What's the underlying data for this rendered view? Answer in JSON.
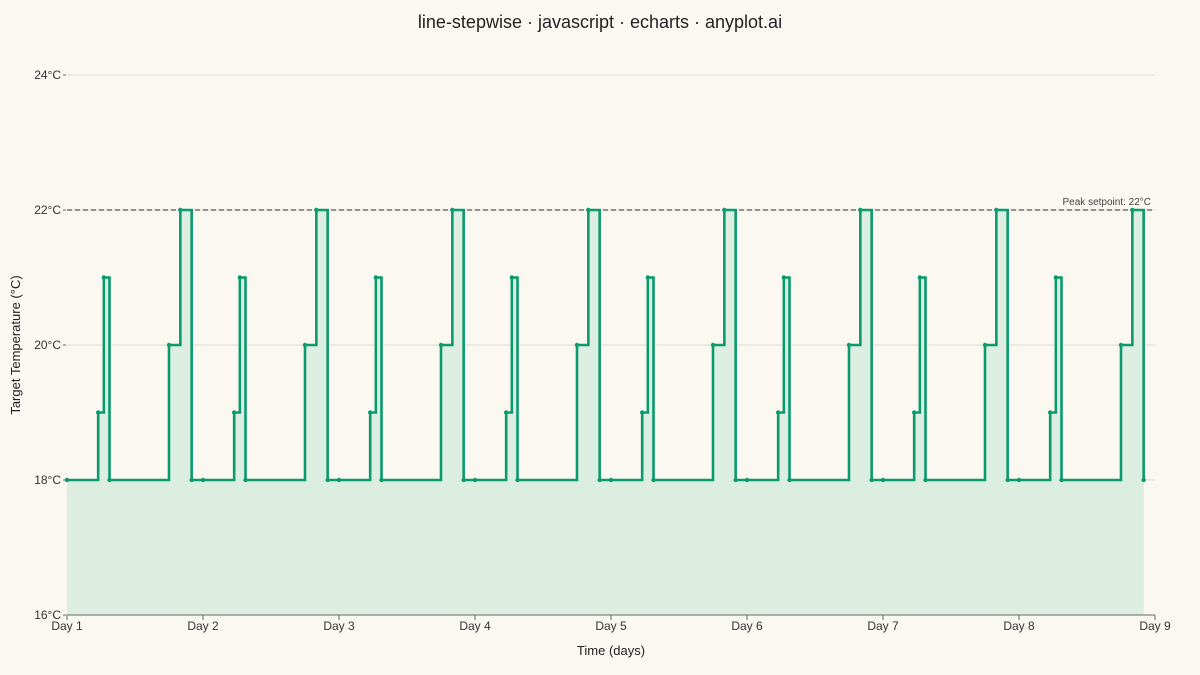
{
  "chart_data": {
    "type": "line",
    "step": "start",
    "title": "line-stepwise · javascript · echarts · anyplot.ai",
    "xlabel": "Time (days)",
    "ylabel": "Target Temperature (°C)",
    "xlim": [
      0,
      192
    ],
    "ylim": [
      16,
      24
    ],
    "x_ticks": [
      {
        "value": 0,
        "label": "Day 1"
      },
      {
        "value": 24,
        "label": "Day 2"
      },
      {
        "value": 48,
        "label": "Day 3"
      },
      {
        "value": 72,
        "label": "Day 4"
      },
      {
        "value": 96,
        "label": "Day 5"
      },
      {
        "value": 120,
        "label": "Day 6"
      },
      {
        "value": 144,
        "label": "Day 7"
      },
      {
        "value": 168,
        "label": "Day 8"
      },
      {
        "value": 192,
        "label": "Day 9"
      }
    ],
    "y_ticks": [
      {
        "value": 16,
        "label": "16°C"
      },
      {
        "value": 18,
        "label": "18°C"
      },
      {
        "value": 20,
        "label": "20°C"
      },
      {
        "value": 22,
        "label": "22°C"
      },
      {
        "value": 24,
        "label": "24°C"
      }
    ],
    "grid": true,
    "area_fill": true,
    "series": [
      {
        "x": [
          0,
          5.5,
          6.5,
          7.5,
          18,
          20,
          22,
          24,
          29.5,
          30.5,
          31.5,
          42,
          44,
          46,
          48,
          53.5,
          54.5,
          55.5,
          66,
          68,
          70,
          72,
          77.5,
          78.5,
          79.5,
          90,
          92,
          94,
          96,
          101.5,
          102.5,
          103.5,
          114,
          116,
          118,
          120,
          125.5,
          126.5,
          127.5,
          138,
          140,
          142,
          144,
          149.5,
          150.5,
          151.5,
          162,
          164,
          166,
          168,
          173.5,
          174.5,
          175.5,
          186,
          188,
          190
        ],
        "y": [
          18,
          19,
          21,
          18,
          20,
          22,
          18,
          18,
          19,
          21,
          18,
          20,
          22,
          18,
          18,
          19,
          21,
          18,
          20,
          22,
          18,
          18,
          19,
          21,
          18,
          20,
          22,
          18,
          18,
          19,
          21,
          18,
          20,
          22,
          18,
          18,
          19,
          21,
          18,
          20,
          22,
          18,
          18,
          19,
          21,
          18,
          20,
          22,
          18,
          18,
          19,
          21,
          18,
          20,
          22,
          18
        ]
      }
    ],
    "mark_line": {
      "value": 22,
      "label": "Peak setpoint: 22°C"
    },
    "colors": {
      "line": "#0B9A6D",
      "area": "#DCEDE2",
      "grid": "#DDDCD5",
      "markline": "#555555",
      "background": "#FAF8F1"
    }
  }
}
